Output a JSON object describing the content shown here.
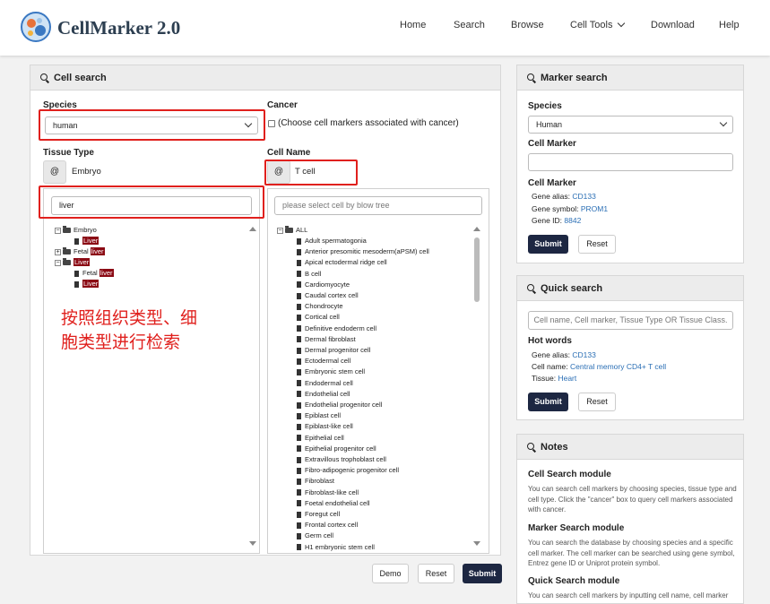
{
  "brand": {
    "name": "CellMarker 2.0",
    "logo_icon": "cell-logo-icon"
  },
  "nav": [
    {
      "label": "Home"
    },
    {
      "label": "Search"
    },
    {
      "label": "Browse"
    },
    {
      "label": "Cell Tools",
      "has_dropdown": true
    },
    {
      "label": "Download"
    },
    {
      "label": "Help"
    }
  ],
  "cell_search": {
    "title": "Cell search",
    "species_label": "Species",
    "species_value": "human",
    "cancer_label": "Cancer",
    "cancer_checkbox_label": "(Choose cell markers associated with cancer)",
    "cancer_checked": false,
    "tissue_type_label": "Tissue Type",
    "tissue_type_prefix": "@",
    "tissue_type_value": "Embryo",
    "tissue_filter_value": "liver",
    "cell_name_label": "Cell Name",
    "cell_name_prefix": "@",
    "cell_name_value": "T cell",
    "cell_filter_placeholder": "please select cell by blow tree",
    "tissue_tree": {
      "embryo": "Embryo",
      "embryo_child": "Liver",
      "fetal_prefix": "Fetal ",
      "fetal_match": "liver",
      "liver": "Liver",
      "liver_fetal_prefix": "Fetal ",
      "liver_fetal_match": "liver",
      "liver_child": "Liver"
    },
    "cell_tree_root": "ALL",
    "cell_tree": [
      "Adult spermatogonia",
      "Anterior presomitic mesoderm(aPSM) cell",
      "Apical ectodermal ridge cell",
      "B cell",
      "Cardiomyocyte",
      "Caudal cortex cell",
      "Chondrocyte",
      "Cortical cell",
      "Definitive endoderm cell",
      "Dermal fibroblast",
      "Dermal progenitor cell",
      "Ectodermal cell",
      "Embryonic stem cell",
      "Endodermal cell",
      "Endothelial cell",
      "Endothelial progenitor cell",
      "Epiblast cell",
      "Epiblast-like cell",
      "Epithelial cell",
      "Epithelial progenitor cell",
      "Extravillous trophoblast cell",
      "Fibro-adipogenic progenitor cell",
      "Fibroblast",
      "Fibroblast-like cell",
      "Foetal endothelial cell",
      "Foregut cell",
      "Frontal cortex cell",
      "Germ cell",
      "H1 embryonic stem cell"
    ],
    "buttons": {
      "demo": "Demo",
      "reset": "Reset",
      "submit": "Submit"
    },
    "annotation": [
      "按照组织类型、细",
      "胞类型进行检索"
    ]
  },
  "marker_search": {
    "title": "Marker search",
    "species_label": "Species",
    "species_value": "Human",
    "cell_marker_label": "Cell Marker",
    "cell_marker_value": "",
    "example_title": "Cell Marker",
    "gene_alias_label": "Gene alias:",
    "gene_alias_value": "CD133",
    "gene_symbol_label": "Gene symbol:",
    "gene_symbol_value": "PROM1",
    "gene_id_label": "Gene ID:",
    "gene_id_value": "8842",
    "submit": "Submit",
    "reset": "Reset"
  },
  "quick_search": {
    "title": "Quick search",
    "placeholder": "Cell name, Cell marker, Tissue Type OR Tissue Class.",
    "hot_words_label": "Hot words",
    "gene_alias_label": "Gene alias:",
    "gene_alias_value": "CD133",
    "cell_name_label": "Cell name:",
    "cell_name_value": "Central memory CD4+ T cell",
    "tissue_label": "Tissue:",
    "tissue_value": "Heart",
    "submit": "Submit",
    "reset": "Reset"
  },
  "notes": {
    "title": "Notes",
    "sections": [
      {
        "heading": "Cell Search module",
        "body": "You can search cell markers by choosing species, tissue type and cell type. Click the \"cancer\" box to query cell markers associated with cancer."
      },
      {
        "heading": "Marker Search module",
        "body": "You can search the database by choosing species and a specific cell marker. The cell marker can be searched using gene symbol, Entrez gene ID or Uniprot protein symbol."
      },
      {
        "heading": "Quick Search module",
        "body": "You can search cell markers by inputting cell name, cell marker"
      }
    ]
  },
  "colors": {
    "accent_dark": "#1d2742",
    "link_blue": "#2b6fb5",
    "highlight_red": "#e0201d",
    "match_bg": "#8b0a14"
  }
}
